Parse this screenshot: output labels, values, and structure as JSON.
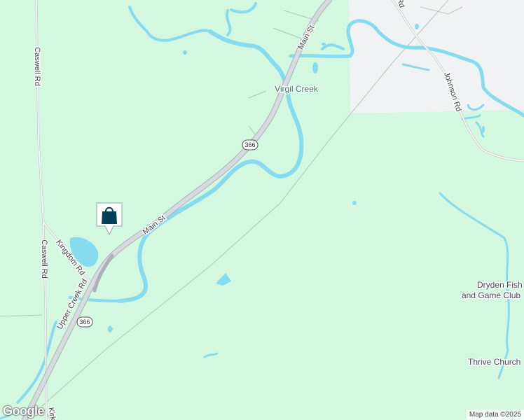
{
  "map": {
    "colors": {
      "land": "#d4f7e0",
      "urban": "#f1f2f3",
      "water": "#86dcee",
      "road": "#c8cdd2",
      "road_outline": "#aab2b8",
      "poi_green": "#2e7d5b",
      "marker_fill": "#003f5c"
    },
    "roads": {
      "main_st_1": "Main St",
      "main_st_2": "Main St",
      "caswell_rd_1": "Caswell Rd",
      "caswell_rd_2": "Caswell Rd",
      "kingdom_rd": "Kingdom Rd",
      "upper_creek_rd": "Upper Creek Rd",
      "johnson_rd": "Johnson Rd",
      "kirk": "Kirk",
      "top_rd": "Rd"
    },
    "route_shields": [
      "366",
      "366"
    ],
    "places": {
      "virgil_creek": "Virgil Creek",
      "dryden_line1": "Dryden Fish",
      "dryden_line2": "and Game Club",
      "thrive_church": "Thrive Church"
    },
    "marker_icon": "shopping-bag-icon",
    "logo": "Google",
    "attribution": "Map data ©2025"
  }
}
